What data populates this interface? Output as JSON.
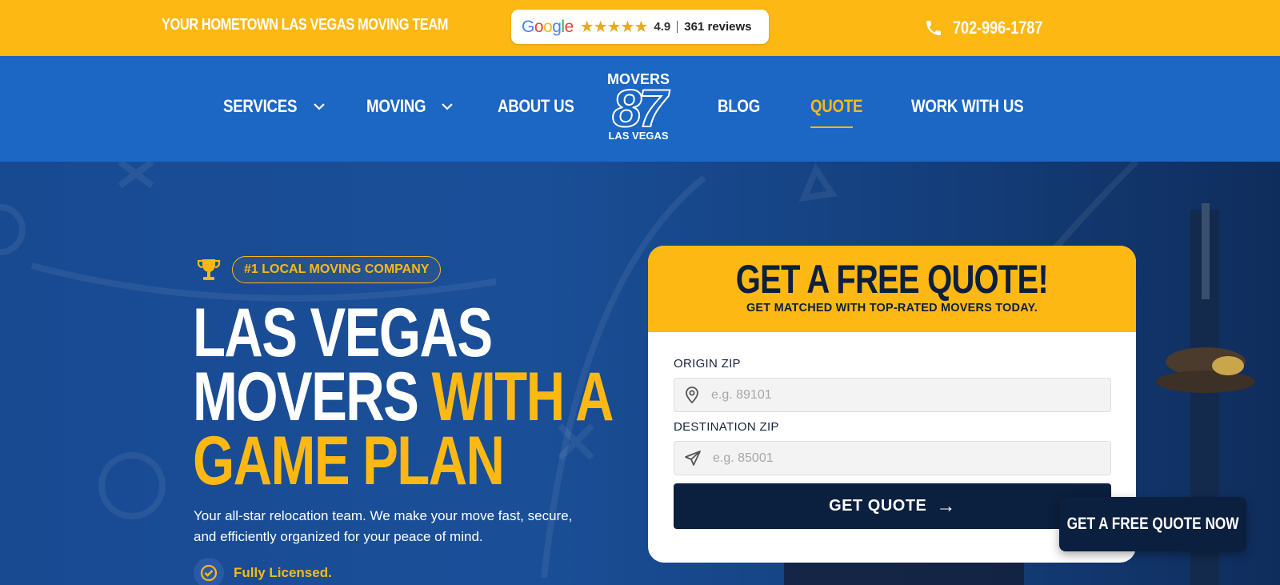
{
  "topbar": {
    "tagline": "YOUR HOMETOWN LAS VEGAS MOVING TEAM",
    "reviews": {
      "stars": "★★★★★",
      "rating": "4.9",
      "count": "361 reviews"
    },
    "phone": "702-996-1787"
  },
  "nav": {
    "items": [
      {
        "label": "SERVICES"
      },
      {
        "label": "MOVING"
      },
      {
        "label": "ABOUT US"
      },
      {
        "label": "BLOG"
      },
      {
        "label": "QUOTE"
      },
      {
        "label": "WORK WITH US"
      }
    ],
    "logo": {
      "line1": "MOVERS",
      "line2": "87",
      "line3": "LAS VEGAS"
    }
  },
  "hero": {
    "badge": "#1 LOCAL MOVING COMPANY",
    "headline_line1": "LAS VEGAS",
    "headline_line2_white": "MOVERS",
    "headline_line2_yellow": "WITH A",
    "headline_line3": "GAME PLAN",
    "subtext": "Your all-star relocation team. We make your move fast, secure, and efficiently organized for your peace of mind.",
    "feature": "Fully Licensed."
  },
  "quote_card": {
    "title": "GET A FREE QUOTE!",
    "subtitle": "GET MATCHED WITH TOP-RATED MOVERS TODAY.",
    "origin_label": "ORIGIN ZIP",
    "origin_placeholder": "e.g. 89101",
    "destination_label": "DESTINATION ZIP",
    "destination_placeholder": "e.g. 85001",
    "submit_label": "GET QUOTE",
    "submit_arrow": "→"
  },
  "float_cta": "GET A FREE QUOTE NOW",
  "colors": {
    "brand_yellow": "#fdb813",
    "brand_blue": "#1c66c4",
    "navy": "#0b1f3e"
  }
}
